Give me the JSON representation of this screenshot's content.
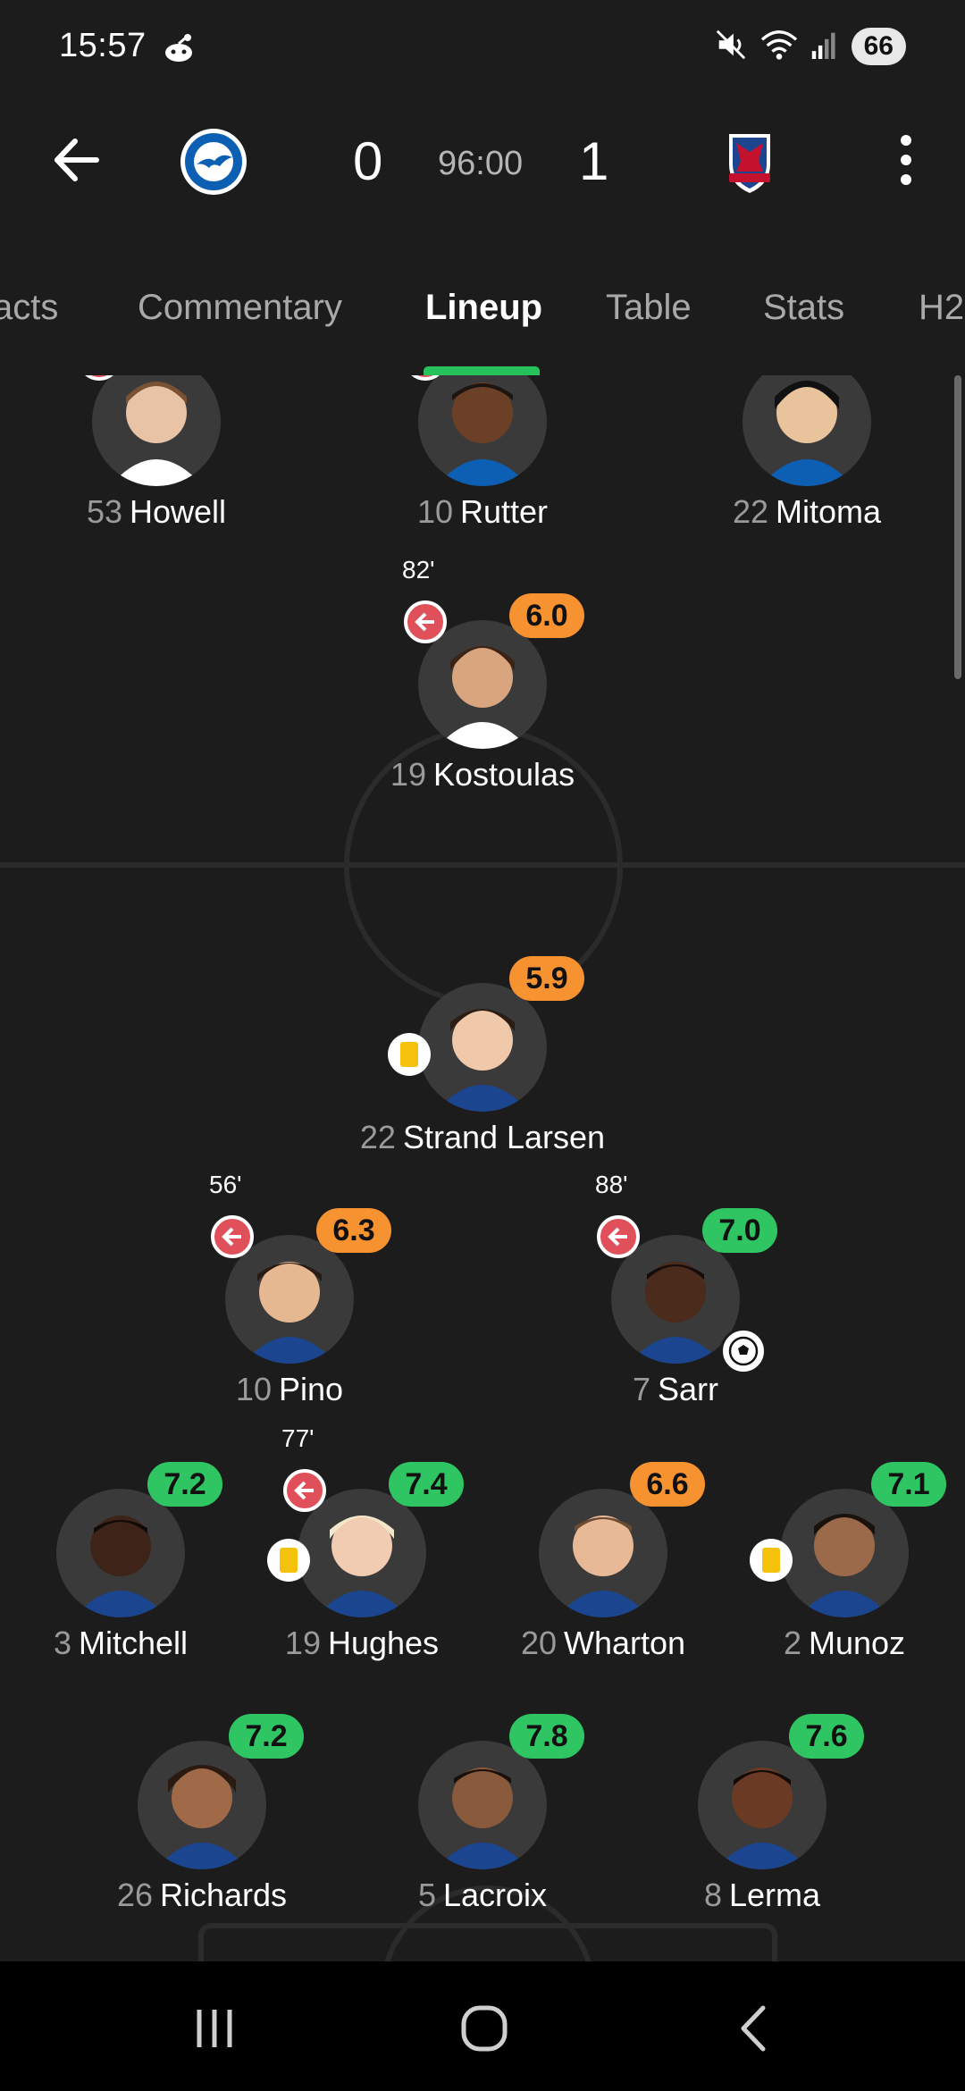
{
  "status_bar": {
    "time": "15:57",
    "battery": "66"
  },
  "match": {
    "home_score": "0",
    "clock": "96:00",
    "away_score": "1"
  },
  "tabs": [
    {
      "label": "acts"
    },
    {
      "label": "Commentary"
    },
    {
      "label": "Lineup",
      "active": true
    },
    {
      "label": "Table"
    },
    {
      "label": "Stats"
    },
    {
      "label": "H2"
    }
  ],
  "players": [
    {
      "number": "53",
      "name": "Howell"
    },
    {
      "number": "10",
      "name": "Rutter"
    },
    {
      "number": "22",
      "name": "Mitoma"
    },
    {
      "number": "19",
      "name": "Kostoulas",
      "rating": "6.0",
      "sub_minute": "82'"
    },
    {
      "number": "22",
      "name": "Strand Larsen",
      "rating": "5.9"
    },
    {
      "number": "10",
      "name": "Pino",
      "rating": "6.3",
      "sub_minute": "56'"
    },
    {
      "number": "7",
      "name": "Sarr",
      "rating": "7.0",
      "sub_minute": "88'"
    },
    {
      "number": "3",
      "name": "Mitchell",
      "rating": "7.2"
    },
    {
      "number": "19",
      "name": "Hughes",
      "rating": "7.4",
      "sub_minute": "77'"
    },
    {
      "number": "20",
      "name": "Wharton",
      "rating": "6.6"
    },
    {
      "number": "2",
      "name": "Munoz",
      "rating": "7.1"
    },
    {
      "number": "26",
      "name": "Richards",
      "rating": "7.2"
    },
    {
      "number": "5",
      "name": "Lacroix",
      "rating": "7.8"
    },
    {
      "number": "8",
      "name": "Lerma",
      "rating": "7.6"
    }
  ],
  "colors": {
    "rating_green": "#2fc563",
    "rating_orange": "#f79231",
    "tab_indicator": "#27c15b",
    "sub_off": "#e0505b",
    "yellow_card": "#f4c20d"
  }
}
